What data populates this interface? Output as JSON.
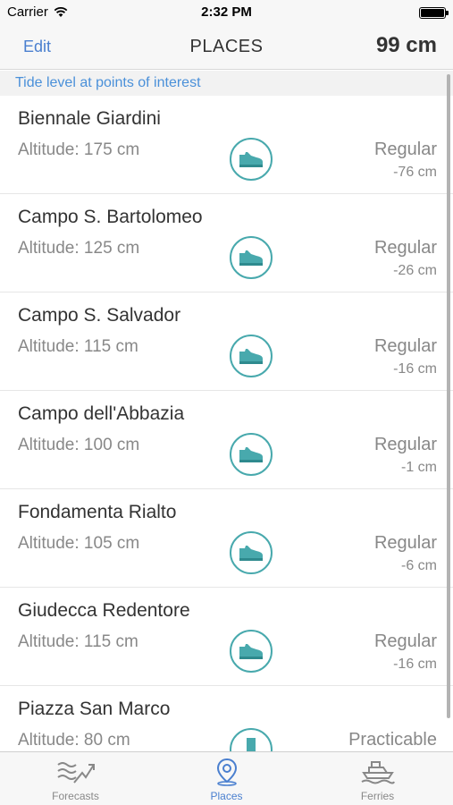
{
  "status_bar": {
    "carrier": "Carrier",
    "time": "2:32 PM"
  },
  "nav": {
    "edit_label": "Edit",
    "title": "PLACES",
    "level": "99 cm"
  },
  "section_header": "Tide level at points of interest",
  "places": [
    {
      "name": "Biennale Giardini",
      "altitude": "Altitude: 175 cm",
      "status": "Regular",
      "diff": "-76 cm",
      "icon": "shoe-icon"
    },
    {
      "name": "Campo S. Bartolomeo",
      "altitude": "Altitude: 125 cm",
      "status": "Regular",
      "diff": "-26 cm",
      "icon": "shoe-icon"
    },
    {
      "name": "Campo S. Salvador",
      "altitude": "Altitude: 115 cm",
      "status": "Regular",
      "diff": "-16 cm",
      "icon": "shoe-icon"
    },
    {
      "name": "Campo dell'Abbazia",
      "altitude": "Altitude: 100 cm",
      "status": "Regular",
      "diff": "-1 cm",
      "icon": "shoe-icon"
    },
    {
      "name": "Fondamenta Rialto",
      "altitude": "Altitude: 105 cm",
      "status": "Regular",
      "diff": "-6 cm",
      "icon": "shoe-icon"
    },
    {
      "name": "Giudecca Redentore",
      "altitude": "Altitude: 115 cm",
      "status": "Regular",
      "diff": "-16 cm",
      "icon": "shoe-icon"
    },
    {
      "name": "Piazza San Marco",
      "altitude": "Altitude: 80 cm",
      "status": "Practicable",
      "diff": "",
      "icon": "boot-icon"
    }
  ],
  "tabs": [
    {
      "label": "Forecasts",
      "icon": "forecasts-icon",
      "active": false
    },
    {
      "label": "Places",
      "icon": "location-pin-icon",
      "active": true
    },
    {
      "label": "Ferries",
      "icon": "ferry-icon",
      "active": false
    }
  ],
  "colors": {
    "accent": "#4a7fcf",
    "icon_teal": "#48a9ad",
    "section_text": "#4a90d9"
  }
}
